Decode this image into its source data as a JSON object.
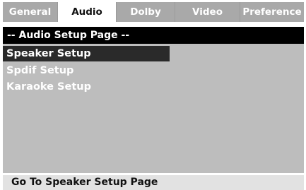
{
  "tabs": [
    {
      "label": "General",
      "active": false
    },
    {
      "label": "Audio",
      "active": true
    },
    {
      "label": "Dolby",
      "active": false
    },
    {
      "label": "Video",
      "active": false
    },
    {
      "label": "Preference",
      "active": false
    }
  ],
  "page_header": "-- Audio Setup Page --",
  "menu": {
    "items": [
      {
        "label": "Speaker Setup",
        "selected": true
      },
      {
        "label": "Spdif Setup",
        "selected": false
      },
      {
        "label": "Karaoke Setup",
        "selected": false
      }
    ]
  },
  "status_text": "Go To Speaker Setup Page",
  "colors": {
    "tab_bg": "#a9a9a9",
    "active_tab_bg": "#ffffff",
    "header_bg": "#000000",
    "panel_bg": "#bdbdbd",
    "selected_item_bg": "#2a2a2a",
    "status_bg": "#e2e2e2"
  }
}
